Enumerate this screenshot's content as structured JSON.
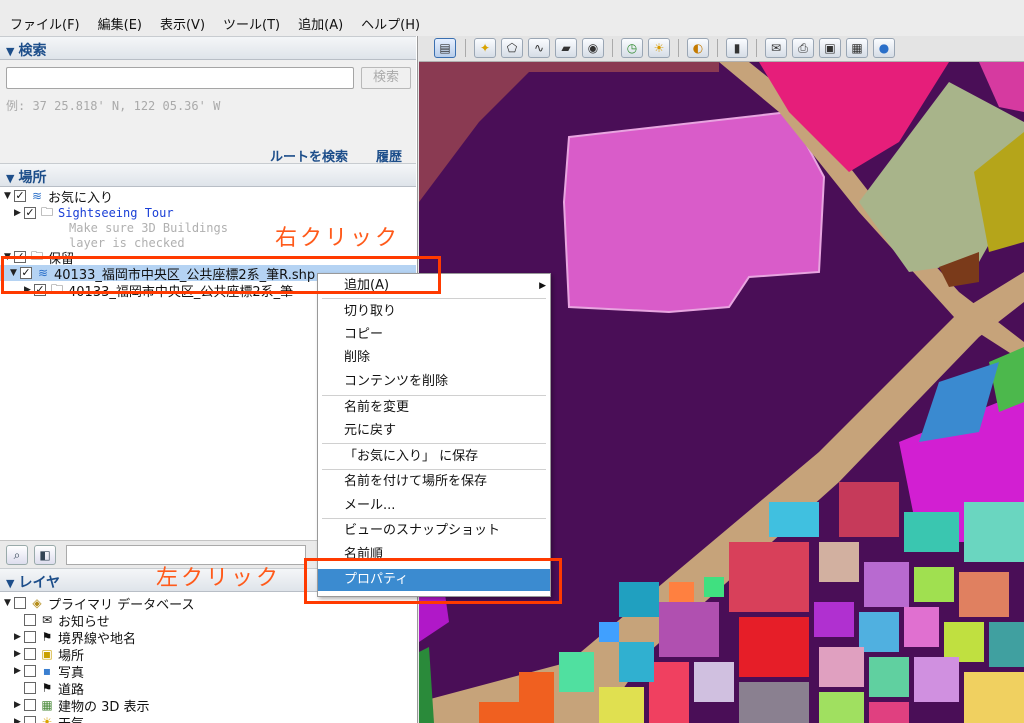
{
  "menubar": {
    "items": [
      "ファイル(F)",
      "編集(E)",
      "表示(V)",
      "ツール(T)",
      "追加(A)",
      "ヘルプ(H)"
    ]
  },
  "search": {
    "header": "検索",
    "input_value": "",
    "button": "検索",
    "example": "例: 37 25.818' N, 122 05.36' W",
    "route_link": "ルートを検索",
    "history_link": "履歴"
  },
  "places": {
    "header": "場所",
    "favorites": "お気に入り",
    "sightseeing": "Sightseeing Tour",
    "note_line1": "Make sure 3D Buildings",
    "note_line2": "layer is checked",
    "temp": "保留",
    "kml_item": "40133_福岡市中央区_公共座標2系_筆R.shp",
    "kml_child": "40133_福岡市中央区_公共座標2系_筆"
  },
  "layers": {
    "header": "レイヤ",
    "root": "プライマリ データベース",
    "items": [
      "お知らせ",
      "境界線や地名",
      "場所",
      "写真",
      "道路",
      "建物の 3D 表示",
      "天気"
    ]
  },
  "context_menu": {
    "add": "追加(A)",
    "cut": "切り取り",
    "copy": "コピー",
    "delete": "削除",
    "delete_contents": "コンテンツを削除",
    "rename": "名前を変更",
    "revert": "元に戻す",
    "save_to_favorites": "「お気に入り」 に保存",
    "save_as": "名前を付けて場所を保存",
    "mail": "メール...",
    "snapshot": "ビューのスナップショット",
    "sort": "名前順",
    "properties": "プロパティ"
  },
  "annotations": {
    "right_click": "右クリック",
    "left_click": "左クリック"
  },
  "colors": {
    "accent_blue": "#1d4e8a",
    "highlight": "#3b8bd0",
    "annotation": "#ff3a00"
  }
}
